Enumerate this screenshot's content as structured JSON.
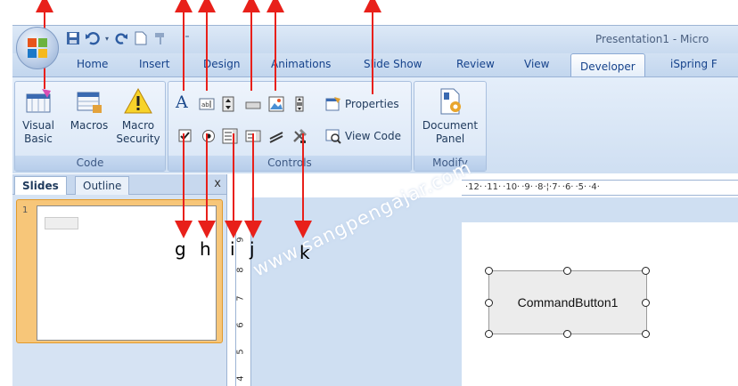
{
  "window": {
    "title": "Presentation1 - Micro"
  },
  "tabs": [
    "Home",
    "Insert",
    "Design",
    "Animations",
    "Slide Show",
    "Review",
    "View",
    "Developer",
    "iSpring F"
  ],
  "active_tab": "Developer",
  "ribbon": {
    "code_group": {
      "label": "Code",
      "visual_basic": "Visual Basic",
      "visual_basic_line1": "Visual",
      "visual_basic_line2": "Basic",
      "macros": "Macros",
      "macro_security_line1": "Macro",
      "macro_security_line2": "Security"
    },
    "controls_group": {
      "label": "Controls",
      "properties": "Properties",
      "view_code": "View Code",
      "label_icon_text": "A"
    },
    "modify_group": {
      "label": "Modify",
      "document_panel_line1": "Document",
      "document_panel_line2": "Panel"
    }
  },
  "left_pane": {
    "tab_slides": "Slides",
    "tab_outline": "Outline",
    "close": "x",
    "slide_number": "1"
  },
  "ruler": {
    "horizontal": "·12· ·11· ·10· ·9· ·8·¦·7· ·6· ·5· ·4·",
    "vertical": [
      "9",
      "8",
      "7",
      "6",
      "5",
      "4"
    ]
  },
  "slide": {
    "command_button": "CommandButton1"
  },
  "annotations": {
    "g": "g",
    "h": "h",
    "i": "i",
    "j": "j",
    "k": "k"
  },
  "watermark": "www.sangpengajar.com",
  "colors": {
    "annotation_arrow": "#e8201a",
    "ribbon_text": "#15428b",
    "thumb_highlight": "#f7c679"
  }
}
